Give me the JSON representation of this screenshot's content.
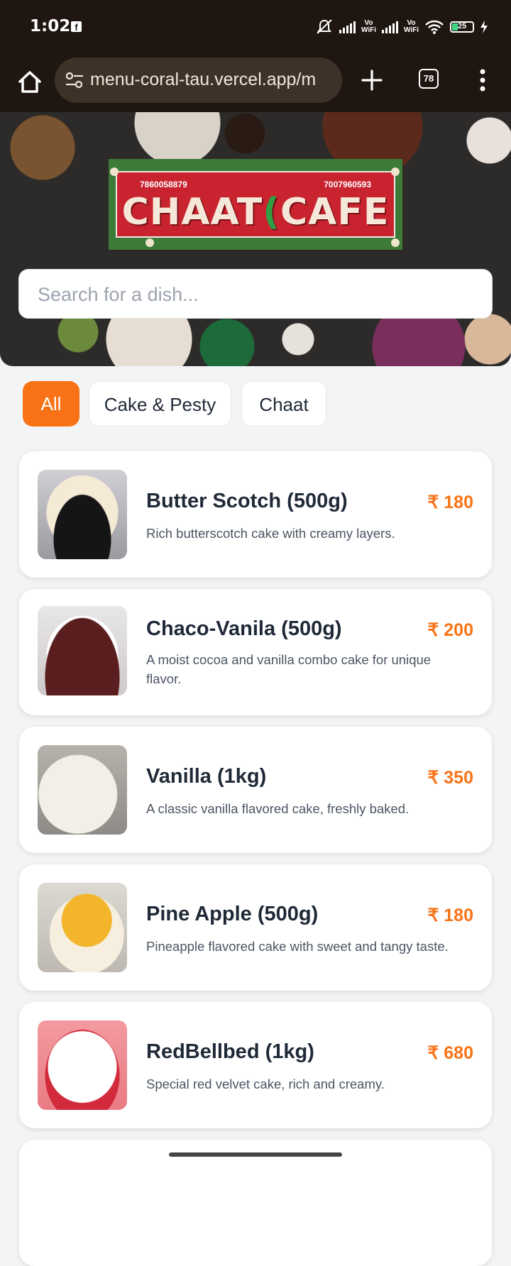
{
  "status_bar": {
    "time": "1:02",
    "battery": "25"
  },
  "browser": {
    "url": "menu-coral-tau.vercel.app/m",
    "tab_count": "78"
  },
  "logo": {
    "phone_left": "7860058879",
    "phone_right": "7007960593",
    "name_left": "CHAAT",
    "name_right": "CAFE"
  },
  "search": {
    "placeholder": "Search for a dish..."
  },
  "categories": [
    {
      "label": "All",
      "active": true
    },
    {
      "label": "Cake & Pesty",
      "active": false
    },
    {
      "label": "Chaat",
      "active": false
    }
  ],
  "menu_items": [
    {
      "title": "Butter Scotch (500g)",
      "price": "₹ 180",
      "description": "Rich butterscotch cake with creamy layers."
    },
    {
      "title": "Chaco-Vanila (500g)",
      "price": "₹ 200",
      "description": "A moist cocoa and vanilla combo cake for unique flavor."
    },
    {
      "title": "Vanilla (1kg)",
      "price": "₹ 350",
      "description": "A classic vanilla flavored cake, freshly baked."
    },
    {
      "title": "Pine Apple (500g)",
      "price": "₹ 180",
      "description": "Pineapple flavored cake with sweet and tangy taste."
    },
    {
      "title": "RedBellbed (1kg)",
      "price": "₹ 680",
      "description": "Special red velvet cake, rich and creamy."
    }
  ],
  "colors": {
    "accent": "#f97316",
    "browser_bg": "#201611"
  }
}
